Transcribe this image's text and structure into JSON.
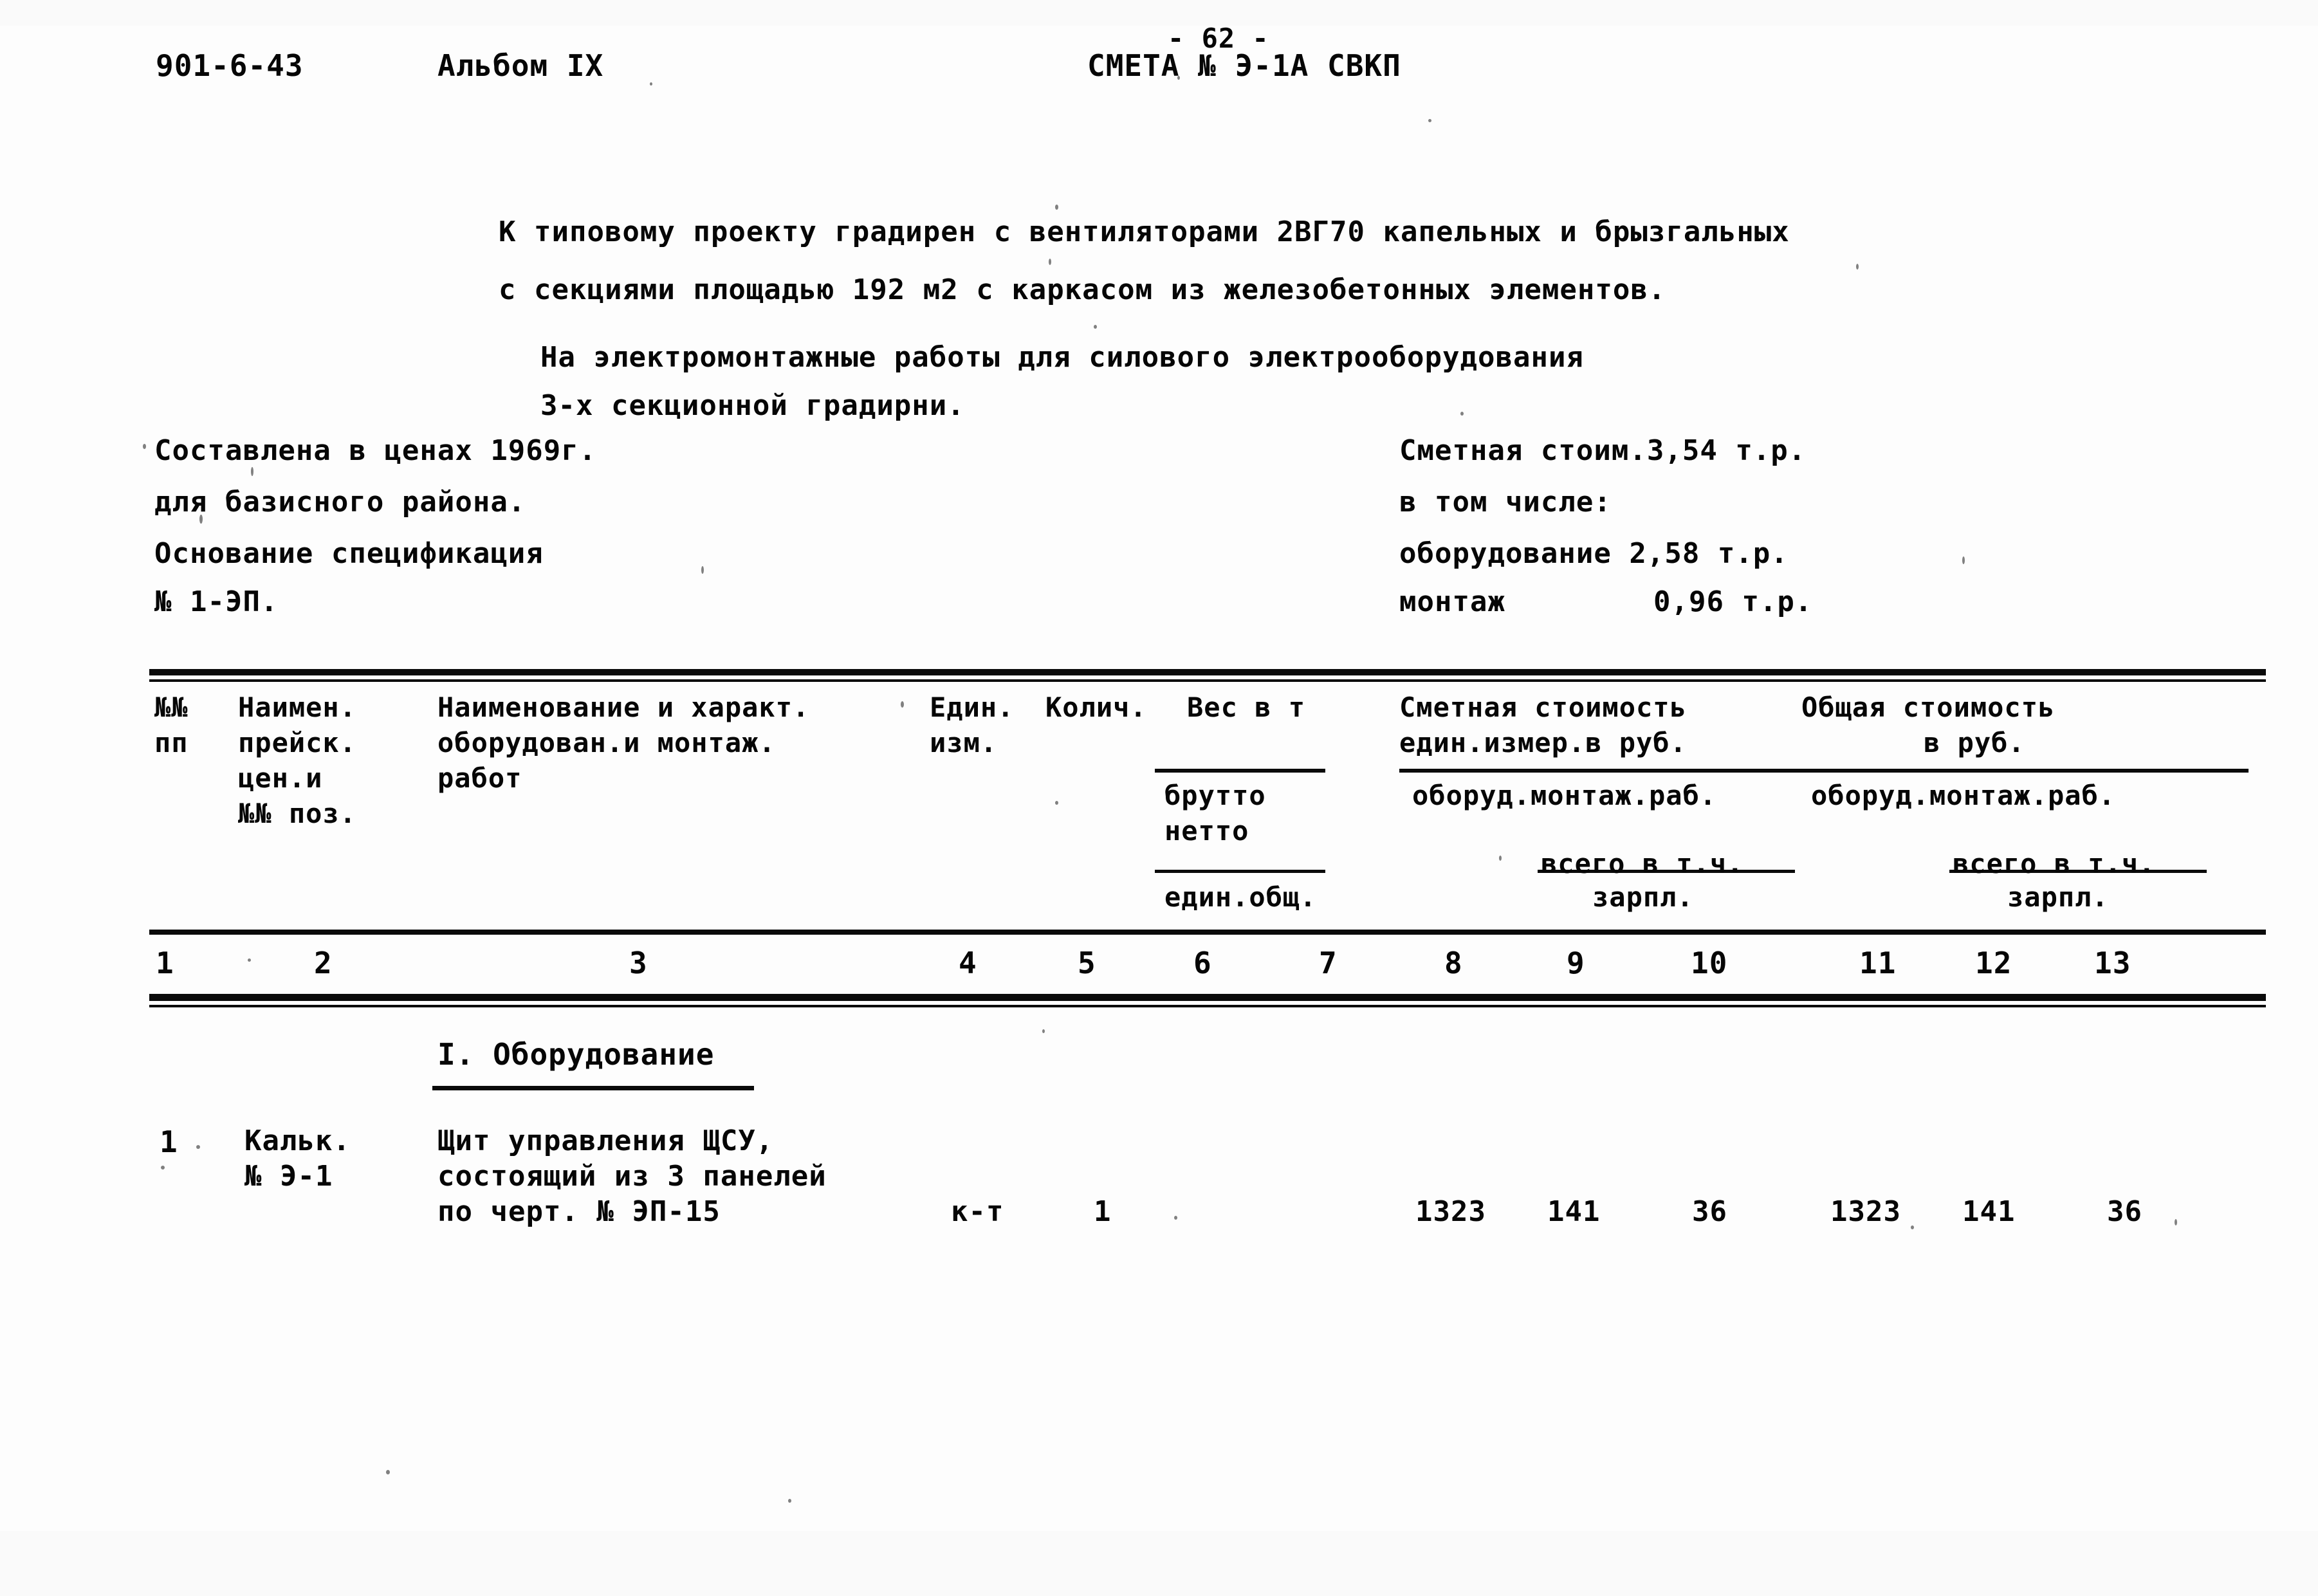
{
  "header": {
    "project_code": "901-6-43",
    "album": "Альбом IX",
    "page_number": "- 62 -",
    "estimate_title": "СМЕТА № Э-1А СВКП"
  },
  "intro": {
    "line1": "К типовому проекту градирен с вентиляторами 2ВГ70 капельных и брызгальных",
    "line2": "с секциями площадью 192 м2 с каркасом из железобетонных элементов.",
    "line3": "На электромонтажные работы для силового электрооборудования",
    "line4": "3-х секционной градирни."
  },
  "info_left": {
    "line1": "Составлена в ценах 1969г.",
    "line2": "для базисного района.",
    "line3": "Основание спецификация",
    "line4": "№ 1-ЭП."
  },
  "info_right": {
    "line1": "Сметная стоим.3,54 т.р.",
    "line2": "в том числе:",
    "line3": "оборудование 2,58 т.р.",
    "line4_label": "монтаж",
    "line4_value": "0,96 т.р."
  },
  "table": {
    "headers": {
      "col1_l1": "№№",
      "col1_l2": "пп",
      "col2_l1": "Наимен.",
      "col2_l2": "прейск.",
      "col2_l3": "цен.и",
      "col2_l4": "№№ поз.",
      "col3_l1": "Наименование и характ.",
      "col3_l2": "оборудован.и монтаж.",
      "col3_l3": "работ",
      "col4_l1": "Един.",
      "col4_l2": "изм.",
      "col5": "Колич.",
      "col6_7": "Вес в т",
      "col8_10_l1": "Сметная стоимость",
      "col8_10_l2": "един.измер.в руб.",
      "col11_13_l1": "Общая стоимость",
      "col11_13_l2": "в руб.",
      "sub_brutto": "брутто",
      "sub_netto": "нетто",
      "sub_edin_obsh": "един.общ.",
      "sub_oborud_montazh": "оборуд.монтаж.раб.",
      "sub_vsego": "всего в т.ч.",
      "sub_zarpl": "зарпл.",
      "sub_oborud_montazh2": "оборуд.монтаж.раб.",
      "sub_vsego2": "всего в т.ч.",
      "sub_zarpl2": "зарпл."
    },
    "column_numbers": [
      "1",
      "2",
      "3",
      "4",
      "5",
      "6",
      "7",
      "8",
      "9",
      "10",
      "11",
      "12",
      "13"
    ],
    "section_title": "I. Оборудование",
    "rows": [
      {
        "num": "1",
        "price_ref_l1": "Кальк.",
        "price_ref_l2": "№ Э-1",
        "name_l1": "Щит управления ЩСУ,",
        "name_l2": "состоящий из 3 панелей",
        "name_l3": "по черт. № ЭП-15",
        "unit": "к-т",
        "qty": "1",
        "weight_gross": "",
        "weight_net": "",
        "unit_oborud": "1323",
        "unit_montazh": "141",
        "unit_zarpl": "36",
        "total_oborud": "1323",
        "total_montazh": "141",
        "total_zarpl": "36"
      }
    ]
  }
}
